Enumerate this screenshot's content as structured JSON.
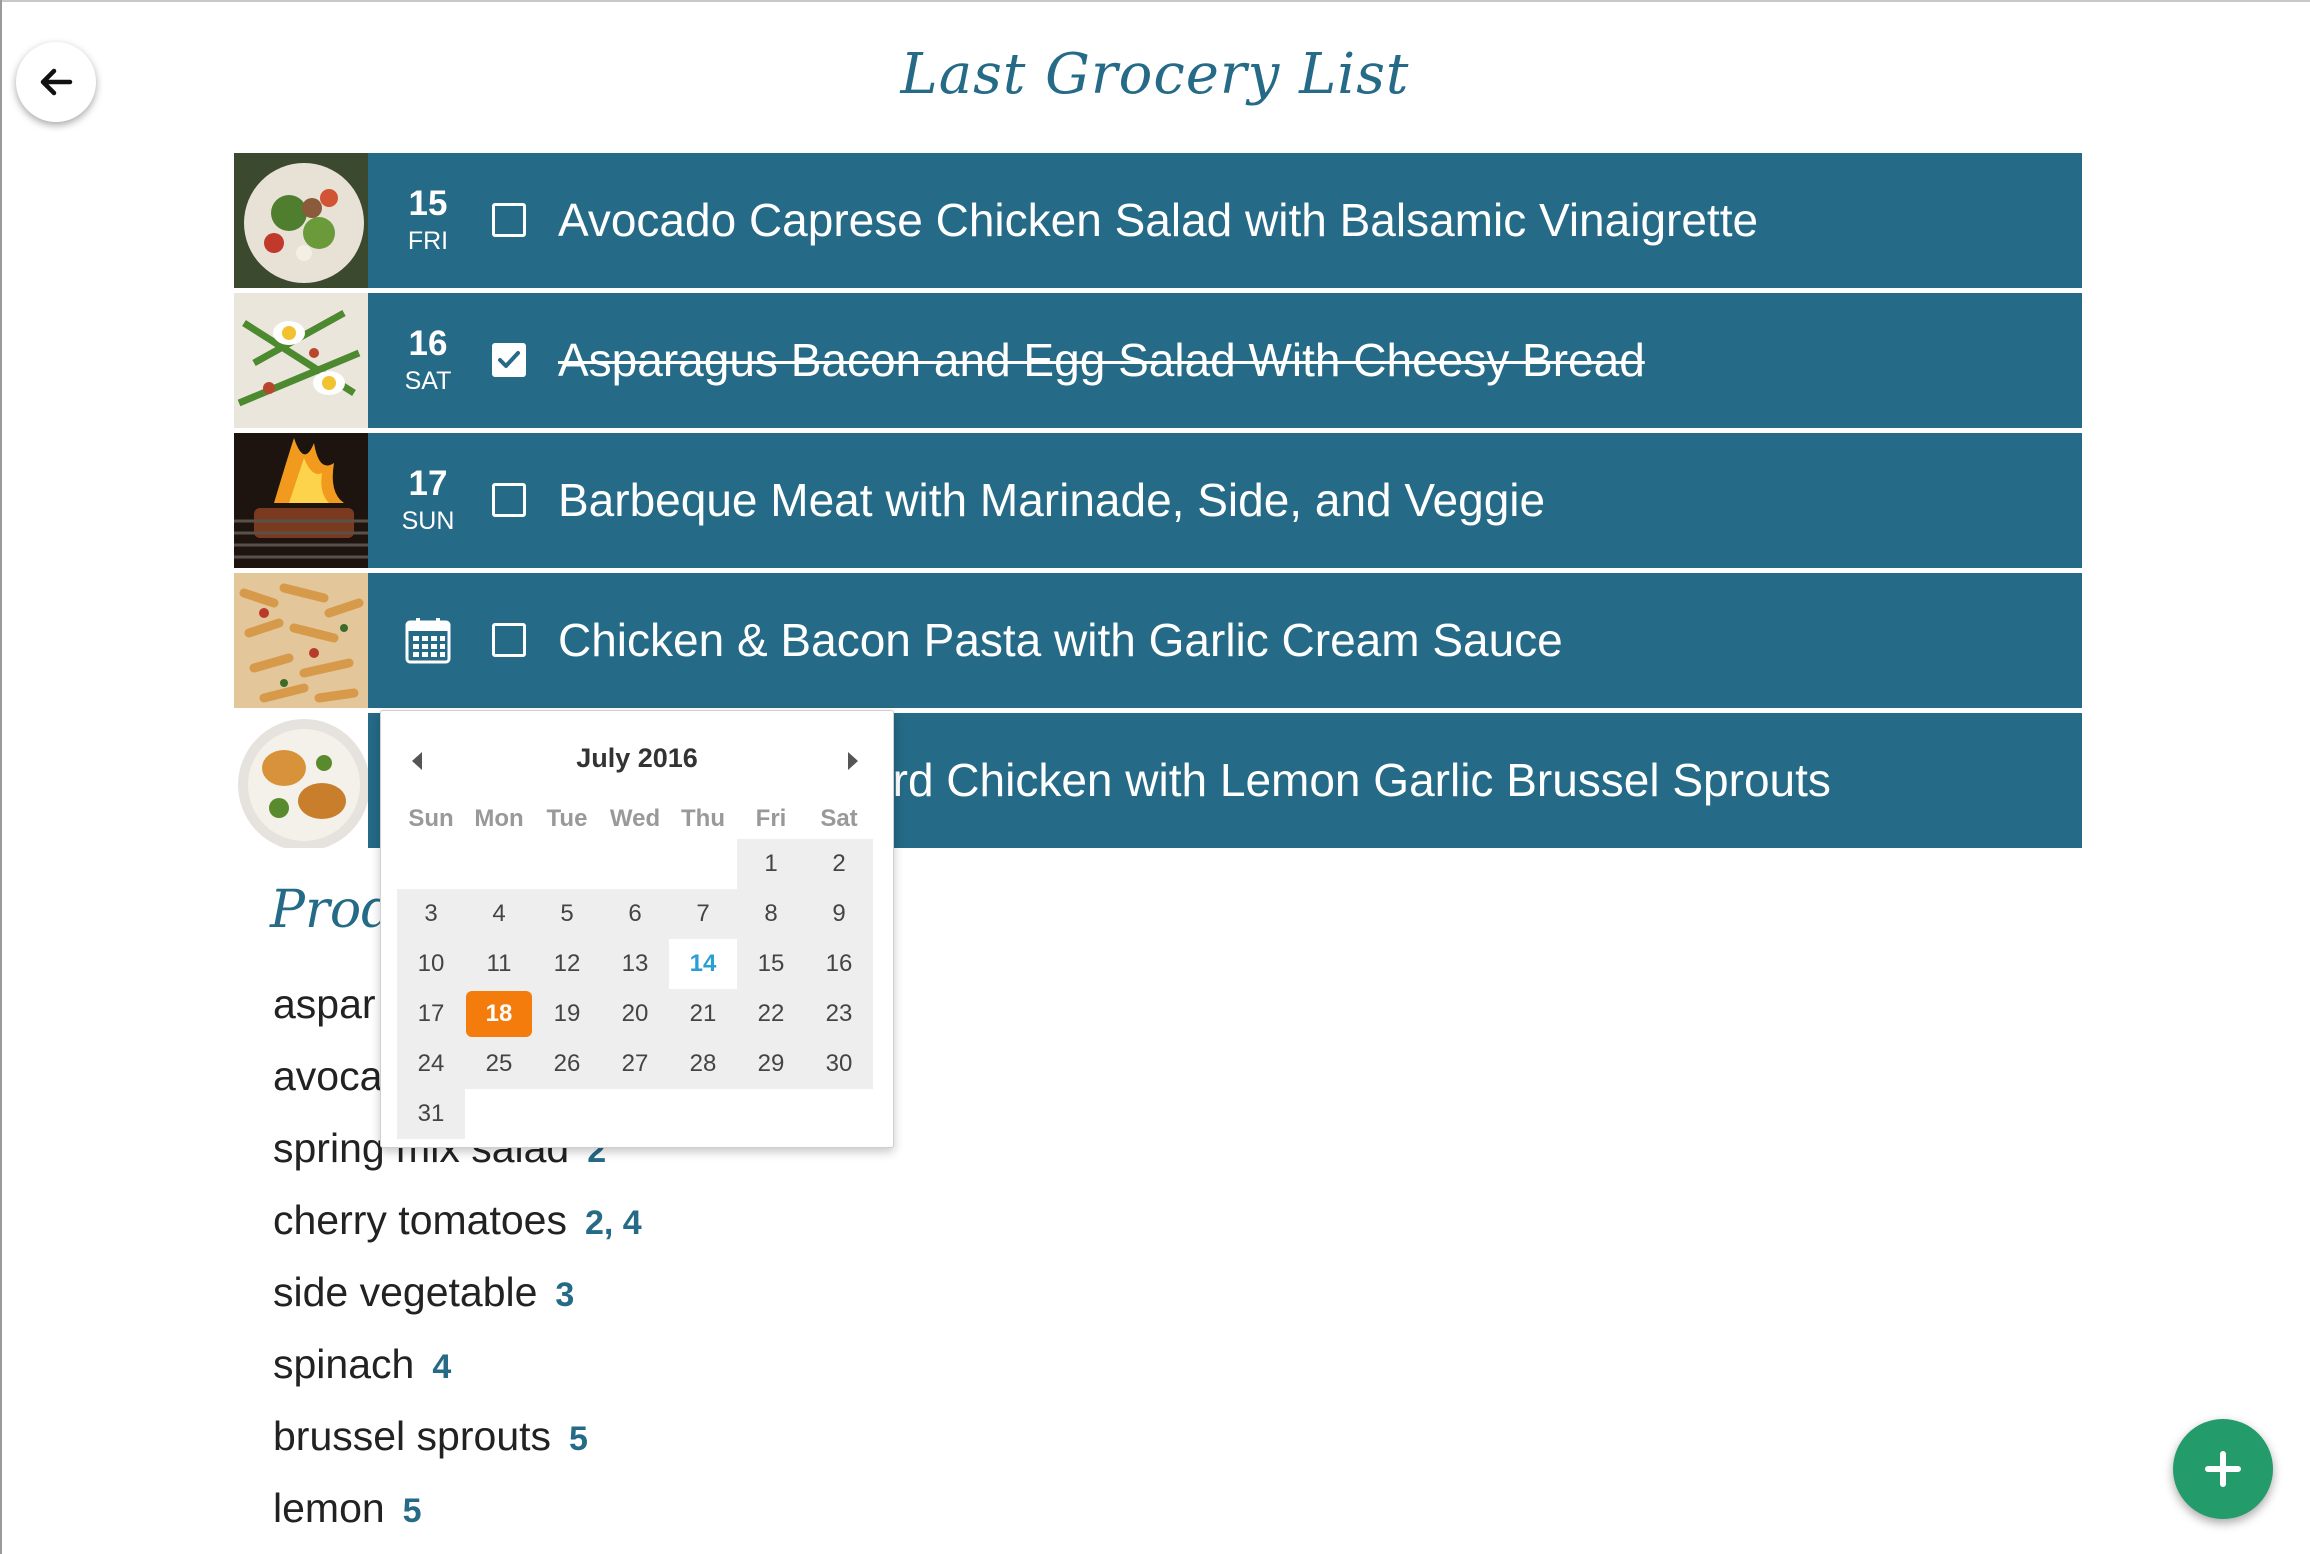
{
  "header": {
    "title": "Last Grocery List"
  },
  "meals": [
    {
      "day": "15",
      "weekday": "FRI",
      "title": "Avocado Caprese Chicken Salad with Balsamic Vinaigrette",
      "checked": false
    },
    {
      "day": "16",
      "weekday": "SAT",
      "title": "Asparagus Bacon and Egg Salad With Cheesy Bread",
      "checked": true
    },
    {
      "day": "17",
      "weekday": "SUN",
      "title": "Barbeque Meat with Marinade, Side, and Veggie",
      "checked": false
    },
    {
      "day": "",
      "weekday": "",
      "title": "Chicken & Bacon Pasta with Garlic Cream Sauce",
      "checked": false,
      "date_icon": "calendar-icon"
    },
    {
      "day": "",
      "weekday": "",
      "title": "ey Mustard Chicken with Lemon Garlic Brussel Sprouts",
      "checked": false
    }
  ],
  "produce": {
    "heading": "Prod",
    "items": [
      {
        "name": "aspar",
        "refs": ""
      },
      {
        "name": "avoca",
        "refs": ""
      },
      {
        "name": "spring mix salad",
        "refs": "2"
      },
      {
        "name": "cherry tomatoes",
        "refs": "2, 4"
      },
      {
        "name": "side vegetable",
        "refs": "3"
      },
      {
        "name": "spinach",
        "refs": "4"
      },
      {
        "name": "brussel sprouts",
        "refs": "5"
      },
      {
        "name": "lemon",
        "refs": "5"
      }
    ]
  },
  "datepicker": {
    "month_label": "July 2016",
    "weekdays": [
      "Sun",
      "Mon",
      "Tue",
      "Wed",
      "Thu",
      "Fri",
      "Sat"
    ],
    "weeks": [
      [
        "",
        "",
        "",
        "",
        "",
        "1",
        "2"
      ],
      [
        "3",
        "4",
        "5",
        "6",
        "7",
        "8",
        "9"
      ],
      [
        "10",
        "11",
        "12",
        "13",
        "14",
        "15",
        "16"
      ],
      [
        "17",
        "18",
        "19",
        "20",
        "21",
        "22",
        "23"
      ],
      [
        "24",
        "25",
        "26",
        "27",
        "28",
        "29",
        "30"
      ],
      [
        "31",
        "",
        "",
        "",
        "",
        "",
        ""
      ]
    ],
    "today": "14",
    "selected": "18"
  },
  "colors": {
    "row_background": "#256a86",
    "accent_selected": "#f47c0c",
    "today": "#2a9fd6",
    "fab": "#239b6b"
  },
  "icons": {
    "back": "arrow-left-icon",
    "prev_month": "caret-left-icon",
    "next_month": "caret-right-icon",
    "fab": "plus-icon"
  }
}
